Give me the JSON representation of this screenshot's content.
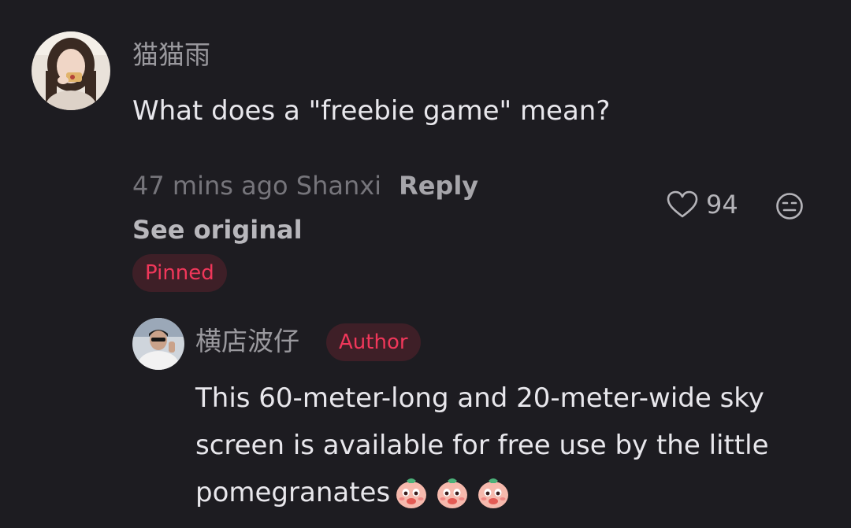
{
  "comment": {
    "username": "猫猫雨",
    "text": "What does a \"freebie game\" mean?",
    "time_location": "47 mins ago Shanxi",
    "reply_label": "Reply",
    "see_original_label": "See original",
    "pinned_label": "Pinned",
    "like_count": "94",
    "avatar_icon": "user-avatar-woman",
    "like_icon": "heart-outline-icon",
    "dislike_icon": "meh-face-icon"
  },
  "reply": {
    "username": "横店波仔",
    "author_badge": "Author",
    "text_lines": [
      "This 60-meter-long and 20-meter-wide sky",
      "screen is available for free use by the little",
      "pomegranates"
    ],
    "emoji_icon": "pomegranate-emoji",
    "emoji_count": 3,
    "avatar_icon": "user-avatar-man"
  },
  "colors": {
    "background": "#1d1c21",
    "badge_bg": "#3e1f27",
    "badge_text": "#f0375a",
    "primary_text": "#e8e7ec",
    "secondary_text": "#9a999e"
  }
}
